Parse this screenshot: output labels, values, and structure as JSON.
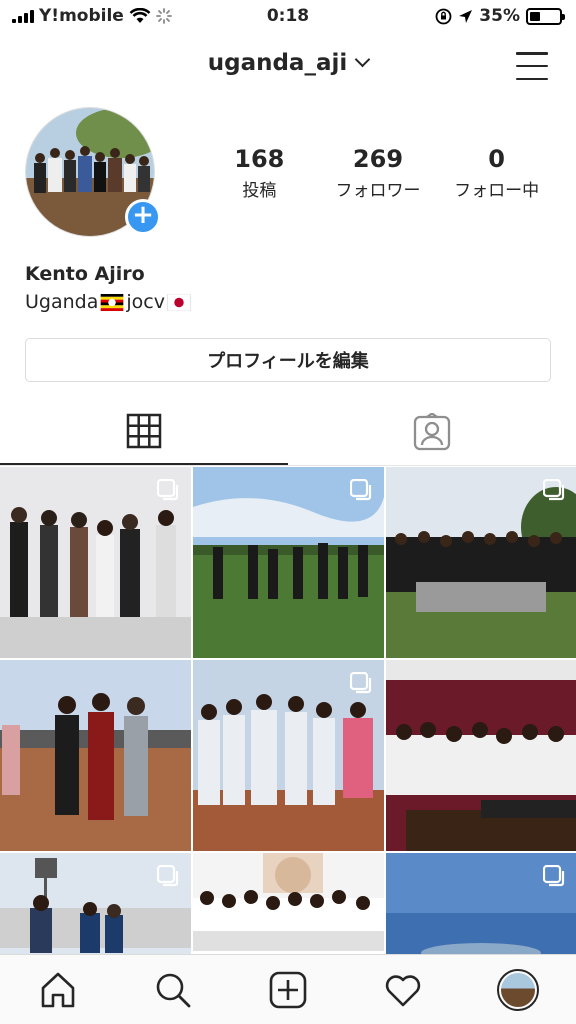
{
  "status_bar": {
    "carrier": "Y!mobile",
    "time": "0:18",
    "battery_percent": "35%",
    "battery_level": 0.35
  },
  "header": {
    "username": "uganda_aji"
  },
  "profile": {
    "stats": [
      {
        "count": "168",
        "label": "投稿"
      },
      {
        "count": "269",
        "label": "フォロワー"
      },
      {
        "count": "0",
        "label": "フォロー中"
      }
    ],
    "name": "Kento Ajiro",
    "bio_part1": "Uganda",
    "bio_part2": "jocv",
    "edit_button": "プロフィールを編集"
  },
  "tabs": [
    {
      "icon": "grid-icon",
      "active": true
    },
    {
      "icon": "tagged-icon",
      "active": false
    }
  ],
  "grid": {
    "tiles": [
      {
        "icon": "multi-photo-icon",
        "multiple": true
      },
      {
        "icon": "multi-photo-icon",
        "multiple": true
      },
      {
        "icon": "multi-photo-icon",
        "multiple": true
      },
      {
        "icon": "",
        "multiple": false
      },
      {
        "icon": "multi-photo-icon",
        "multiple": true
      },
      {
        "icon": "",
        "multiple": false
      },
      {
        "icon": "multi-photo-icon",
        "multiple": true
      },
      {
        "icon": "",
        "multiple": false
      },
      {
        "icon": "multi-photo-icon",
        "multiple": true
      }
    ]
  },
  "bottom_nav": [
    {
      "icon": "home-icon"
    },
    {
      "icon": "search-icon"
    },
    {
      "icon": "new-post-icon"
    },
    {
      "icon": "activity-heart-icon"
    },
    {
      "icon": "profile-avatar-icon"
    }
  ],
  "colors": {
    "accent_blue": "#3897f0",
    "text": "#262626",
    "border": "#dbdbdb"
  }
}
